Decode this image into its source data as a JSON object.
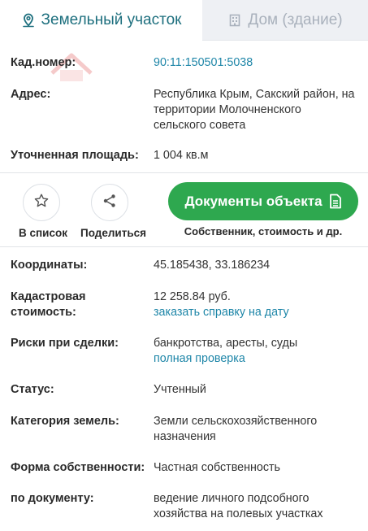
{
  "tabs": [
    {
      "label": "Земельный участок",
      "icon": "map-pin-icon",
      "active": true
    },
    {
      "label": "Дом (здание)",
      "icon": "building-icon",
      "active": false
    }
  ],
  "top_fields": [
    {
      "label": "Кад.номер:",
      "value": "90:11:150501:5038",
      "is_link": true
    },
    {
      "label": "Адрес:",
      "value": "Республика Крым, Сакский район, на территории Молочненского сельского совета"
    },
    {
      "label": "Уточненная площадь:",
      "value": "1 004 кв.м"
    }
  ],
  "actions": {
    "favorite_label": "В список",
    "share_label": "Поделиться",
    "docs_button_label": "Документы объекта",
    "docs_caption": "Собственник, стоимость и др."
  },
  "details": {
    "coords": {
      "label": "Координаты:",
      "value": "45.185438, 33.186234"
    },
    "cadastral_cost": {
      "label": "Кадастровая стоимость:",
      "value": "12 258.84 руб.",
      "link": "заказать справку на дату"
    },
    "risks": {
      "label": "Риски при сделки:",
      "value": "банкротства, аресты, суды",
      "link": "полная проверка"
    },
    "status": {
      "label": "Статус:",
      "value": "Учтенный"
    },
    "category": {
      "label": "Категория земель:",
      "value": "Земли сельскохозяйственного назначения"
    },
    "ownership": {
      "label": "Форма собственности:",
      "value": "Частная собственность"
    },
    "by_doc": {
      "label": "по документу:",
      "value": "ведение личного подсобного хозяйства на полевых участках"
    }
  },
  "colors": {
    "accent": "#1d6f7e",
    "link": "#1e86a8",
    "primary_button": "#2ea84f"
  }
}
